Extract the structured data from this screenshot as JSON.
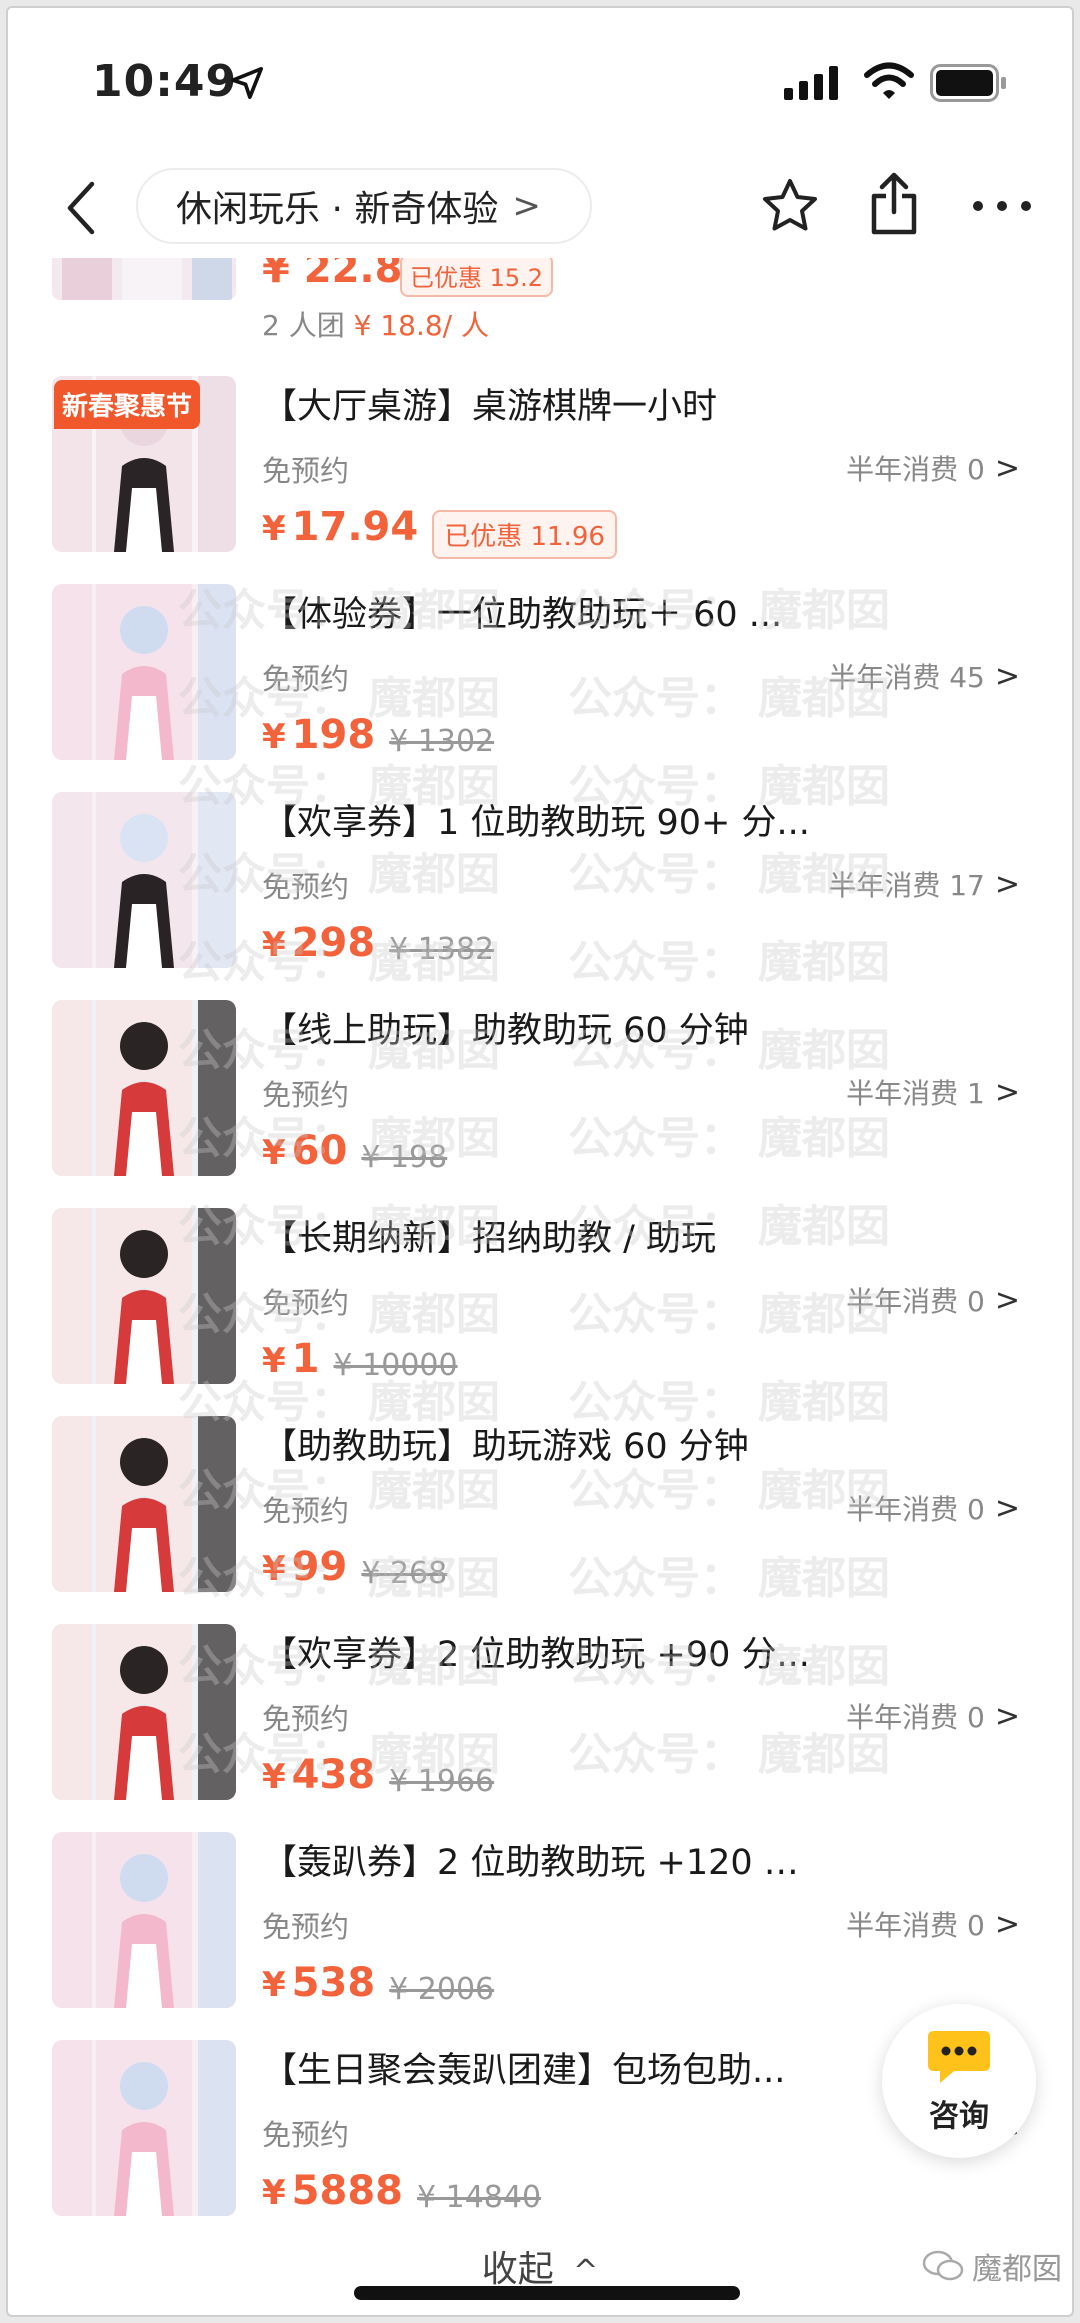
{
  "status_bar": {
    "time": "10:49"
  },
  "nav": {
    "breadcrumb": "休闲玩乐 · 新奇体验",
    "breadcrumb_chevron": ">"
  },
  "partial_item": {
    "price": "¥ 22.8",
    "saved": "已优惠 15.2",
    "group_label": "2 人团",
    "group_price": "¥ 18.8/ 人"
  },
  "items": [
    {
      "promo": "新春聚惠节",
      "title": "【大厅桌游】桌游棋牌一小时",
      "booking": "免预约",
      "sales": "半年消费 0",
      "price": "17.94",
      "original": "",
      "saved": "已优惠 11.96"
    },
    {
      "promo": "",
      "title": "【体验券】一位助教助玩＋ 60 ...",
      "booking": "免预约",
      "sales": "半年消费 45",
      "price": "198",
      "original": "¥ 1302",
      "saved": ""
    },
    {
      "promo": "",
      "title": "【欢享券】1 位助教助玩 90+ 分...",
      "booking": "免预约",
      "sales": "半年消费 17",
      "price": "298",
      "original": "¥ 1382",
      "saved": ""
    },
    {
      "promo": "",
      "title": "【线上助玩】助教助玩 60 分钟",
      "booking": "免预约",
      "sales": "半年消费 1",
      "price": "60",
      "original": "¥ 198",
      "saved": ""
    },
    {
      "promo": "",
      "title": "【长期纳新】招纳助教 / 助玩",
      "booking": "免预约",
      "sales": "半年消费 0",
      "price": "1",
      "original": "¥ 10000",
      "saved": ""
    },
    {
      "promo": "",
      "title": "【助教助玩】助玩游戏 60 分钟",
      "booking": "免预约",
      "sales": "半年消费 0",
      "price": "99",
      "original": "¥ 268",
      "saved": ""
    },
    {
      "promo": "",
      "title": "【欢享券】2 位助教助玩 +90 分...",
      "booking": "免预约",
      "sales": "半年消费 0",
      "price": "438",
      "original": "¥ 1966",
      "saved": ""
    },
    {
      "promo": "",
      "title": "【轰趴券】2 位助教助玩 +120 分...",
      "booking": "免预约",
      "sales": "半年消费 0",
      "price": "538",
      "original": "¥ 2006",
      "saved": ""
    },
    {
      "promo": "",
      "title": "【生日聚会轰趴团建】包场包助...",
      "booking": "免预约",
      "sales": "半...",
      "price": "5888",
      "original": "¥ 14840",
      "saved": ""
    }
  ],
  "currency": "¥",
  "chevron": ">",
  "watermark": {
    "left": "公众号：",
    "right": "魔都囡"
  },
  "consult": {
    "label": "咨询"
  },
  "collapse": {
    "label": "收起",
    "icon": "^"
  },
  "footer": {
    "wechat_label": "魔都囡"
  },
  "colors": {
    "accent": "#f2623b",
    "promo": "#f0572a"
  }
}
